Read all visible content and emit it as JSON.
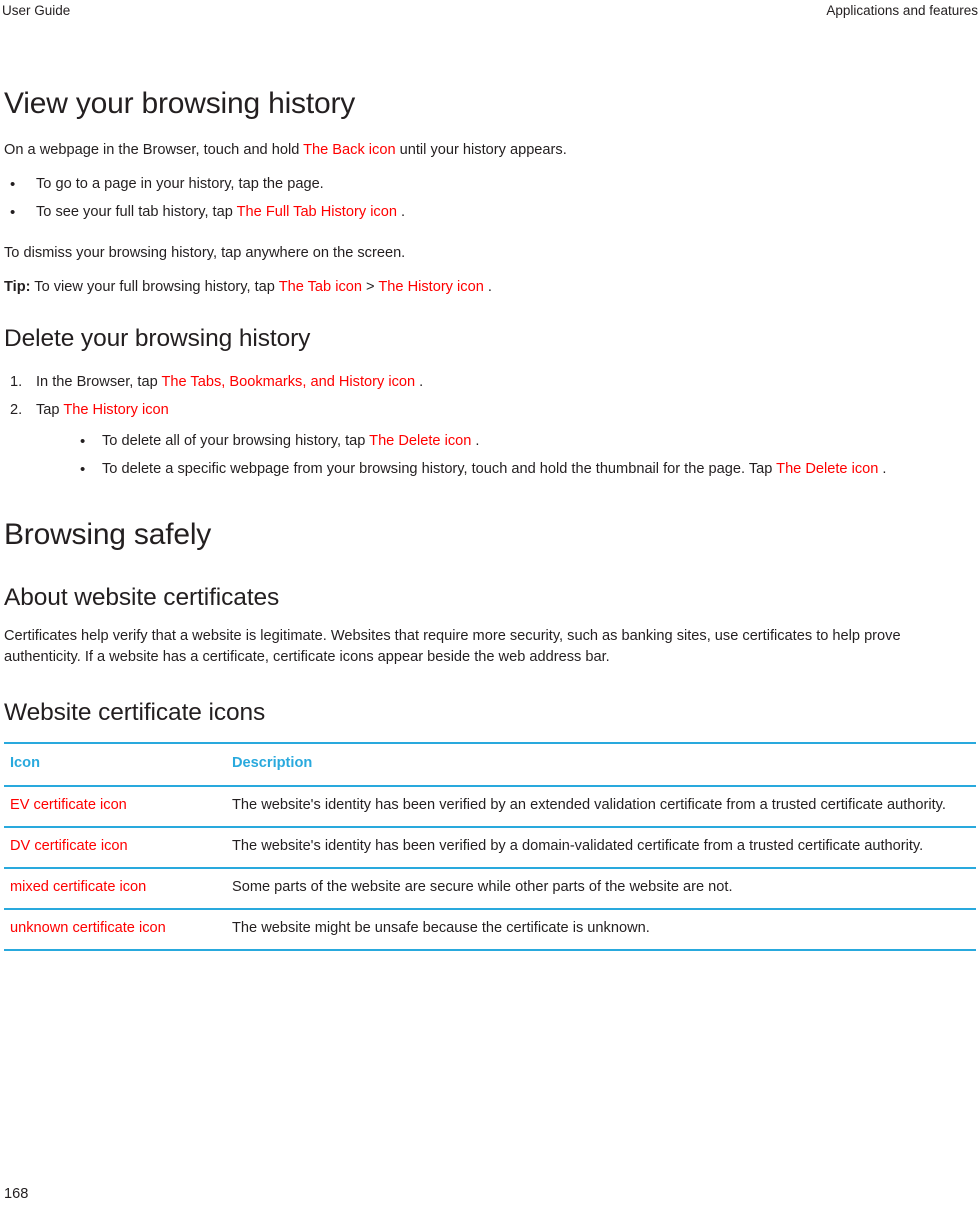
{
  "header": {
    "left": "User Guide",
    "right": "Applications and features"
  },
  "sections": {
    "view_history": {
      "heading": "View your browsing history",
      "intro_part1": "On a webpage in the Browser, touch and hold ",
      "intro_icon": "The Back icon",
      "intro_part2": " until your history appears.",
      "bullets": [
        {
          "text_before": "To go to a page in your history, tap the page.",
          "icon": "",
          "text_after": ""
        },
        {
          "text_before": "To see your full tab history, tap ",
          "icon": "The Full Tab History icon",
          "text_after": " ."
        }
      ],
      "dismiss_text": "To dismiss your browsing history, tap anywhere on the screen.",
      "tip_label": "Tip:",
      "tip_part1": " To view your full browsing history, tap ",
      "tip_icon1": "The Tab icon",
      "tip_separator": " > ",
      "tip_icon2": "The History icon",
      "tip_part2": " ."
    },
    "delete_history": {
      "heading": "Delete your browsing history",
      "steps": [
        {
          "number": "1.",
          "text_before": "In the Browser, tap ",
          "icon": "The Tabs, Bookmarks, and History icon",
          "text_after": " ."
        },
        {
          "number": "2.",
          "text_before": "Tap ",
          "icon": "The History icon",
          "text_after": ""
        }
      ],
      "sub_bullets": [
        {
          "text_before": "To delete all of your browsing history, tap ",
          "icon": "The Delete icon",
          "text_after": " ."
        },
        {
          "text_before": "To delete a specific webpage from your browsing history, touch and hold the thumbnail for the page. Tap ",
          "icon": "The Delete icon",
          "text_after": " ."
        }
      ]
    },
    "browsing_safely": {
      "heading": "Browsing safely"
    },
    "about_certificates": {
      "heading": "About website certificates",
      "paragraph": "Certificates help verify that a website is legitimate. Websites that require more security, such as banking sites, use certificates to help prove authenticity. If a website has a certificate, certificate icons appear beside the web address bar."
    },
    "certificate_icons": {
      "heading": "Website certificate icons",
      "table": {
        "columns": [
          "Icon",
          "Description"
        ],
        "rows": [
          {
            "icon": "EV certificate icon",
            "description": "The website's identity has been verified by an extended validation certificate from a trusted certificate authority."
          },
          {
            "icon": "DV certificate icon",
            "description": "The website's identity has been verified by a domain-validated certificate from a trusted certificate authority."
          },
          {
            "icon": "mixed certificate icon",
            "description": "Some parts of the website are secure while other parts of the website are not."
          },
          {
            "icon": "unknown certificate icon",
            "description": "The website might be unsafe because the certificate is unknown."
          }
        ]
      }
    }
  },
  "footer": {
    "page_number": "168"
  },
  "colors": {
    "icon_placeholder_red": "#ff0000",
    "table_accent_cyan": "#29a9dd",
    "body_text": "#231f20"
  }
}
